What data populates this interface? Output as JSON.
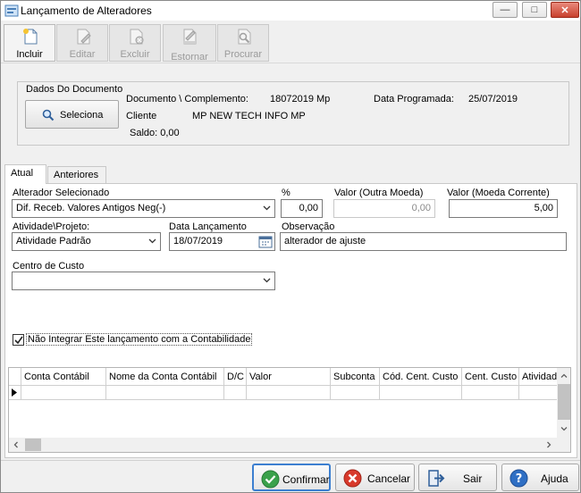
{
  "window": {
    "title": "Lançamento de Alteradores"
  },
  "toolbar": {
    "incluir": "Incluir",
    "editar": "Editar",
    "excluir": "Excluir",
    "estornar": "Estornar",
    "procurar": "Procurar"
  },
  "documento": {
    "group_title": "Dados Do Documento",
    "seleciona_label": "Seleciona",
    "doc_label": "Documento \\ Complemento:",
    "doc_value": "18072019  Mp",
    "data_prog_label": "Data Programada:",
    "data_prog_value": "25/07/2019",
    "cliente_label": "Cliente",
    "cliente_value": "MP NEW TECH INFO MP",
    "saldo": "Saldo: 0,00"
  },
  "tabs": [
    "Atual",
    "Anteriores"
  ],
  "form": {
    "alterador_label": "Alterador Selecionado",
    "alterador_value": "Dif. Receb. Valores Antigos Neg(-)",
    "pct_label": "%",
    "pct_value": "0,00",
    "valor_outra_label": "Valor (Outra Moeda)",
    "valor_outra_value": "0,00",
    "valor_corrente_label": "Valor (Moeda Corrente)",
    "valor_corrente_value": "5,00",
    "atividade_label": "Atividade\\Projeto:",
    "atividade_value": "Atividade Padrão",
    "data_lanc_label": "Data Lançamento",
    "data_lanc_value": "18/07/2019",
    "obs_label": "Observação",
    "obs_value": "alterador de ajuste",
    "centro_label": "Centro de Custo",
    "centro_value": "",
    "nao_integrar_label": "Não Integrar Este lançamento com a Contabilidade",
    "nao_integrar_checked": true
  },
  "grid": {
    "columns": [
      "Conta Contábil",
      "Nome da Conta Contábil",
      "D/C",
      "Valor",
      "Subconta",
      "Cód. Cent. Custo",
      "Cent. Custo",
      "Atividade"
    ]
  },
  "buttons": {
    "confirmar": "Confirmar",
    "cancelar": "Cancelar",
    "sair": "Sair",
    "ajuda": "Ajuda"
  },
  "icons": {
    "app": "app-icon",
    "incluir": "new-document-icon",
    "editar": "edit-document-icon",
    "excluir": "delete-document-icon",
    "estornar": "reverse-document-icon",
    "procurar": "search-document-icon",
    "seleciona": "magnifier-icon",
    "confirmar": "check-icon",
    "cancelar": "cancel-icon",
    "sair": "exit-icon",
    "ajuda": "help-icon"
  }
}
